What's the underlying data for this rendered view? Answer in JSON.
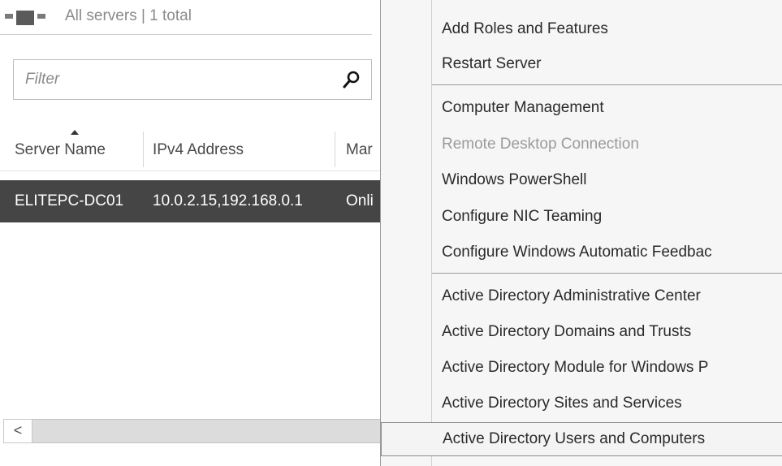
{
  "header": {
    "title": "All servers | 1 total"
  },
  "filter": {
    "placeholder": "Filter",
    "value": ""
  },
  "columns": [
    "Server Name",
    "IPv4 Address",
    "Mar"
  ],
  "rows": [
    {
      "server_name": "ELITEPC-DC01",
      "ipv4": "10.0.2.15,192.168.0.1",
      "manageability": "Onli"
    }
  ],
  "scrollbar": {
    "left_arrow": "<"
  },
  "context_menu": {
    "items": [
      {
        "label": "Add Roles and Features",
        "state": "enabled"
      },
      {
        "label": "Restart Server",
        "state": "enabled"
      },
      {
        "label": "Computer Management",
        "state": "enabled"
      },
      {
        "label": "Remote Desktop Connection",
        "state": "disabled"
      },
      {
        "label": "Windows PowerShell",
        "state": "enabled"
      },
      {
        "label": "Configure NIC Teaming",
        "state": "enabled"
      },
      {
        "label": "Configure Windows Automatic Feedbac",
        "state": "enabled"
      },
      {
        "label": "Active Directory Administrative Center",
        "state": "enabled"
      },
      {
        "label": "Active Directory Domains and Trusts",
        "state": "enabled"
      },
      {
        "label": "Active Directory Module for Windows P",
        "state": "enabled"
      },
      {
        "label": "Active Directory Sites and Services",
        "state": "enabled"
      },
      {
        "label": "Active Directory Users and Computers",
        "state": "highlighted"
      }
    ]
  },
  "icons": {
    "header": "servers-group-icon",
    "filter": "search-icon",
    "sort": "sort-ascending-icon"
  },
  "colors": {
    "selected_row_bg": "#454545",
    "menu_bg": "#f6f6f6",
    "disabled_text": "#9b9b9b"
  }
}
